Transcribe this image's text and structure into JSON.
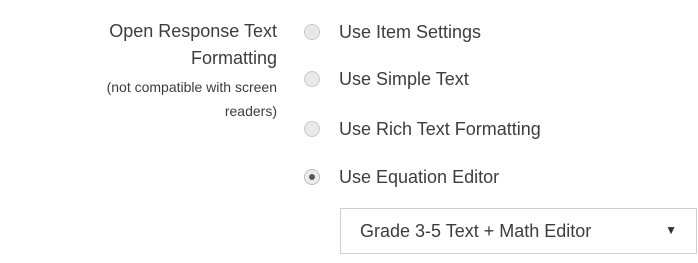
{
  "setting": {
    "label_line1": "Open Response Text",
    "label_line2": "Formatting",
    "note_line1": "(not compatible with screen",
    "note_line2": "readers)"
  },
  "options": [
    {
      "label": "Use Item Settings",
      "checked": false
    },
    {
      "label": "Use Simple Text",
      "checked": false
    },
    {
      "label": "Use Rich Text Formatting",
      "checked": false
    },
    {
      "label": "Use Equation Editor",
      "checked": true
    }
  ],
  "editor_select": {
    "selected_value": "Grade 3-5 Text + Math Editor",
    "arrow_icon": "triangle-down-icon"
  },
  "colors": {
    "text": "#3d3d3d",
    "radio_fill": "#e9e9e9",
    "radio_dot": "#555555",
    "select_border": "#cfcfcf"
  }
}
